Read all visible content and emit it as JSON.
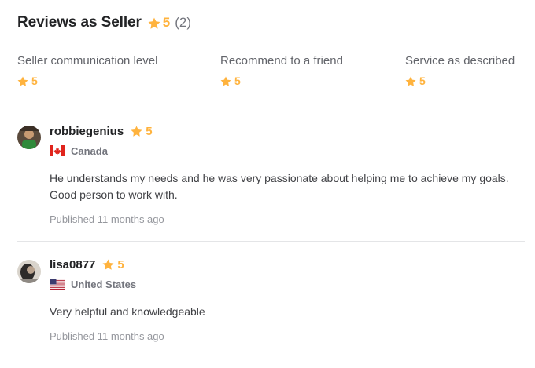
{
  "header": {
    "title": "Reviews as Seller",
    "rating": "5",
    "count": "(2)",
    "star_icon": "star-icon",
    "star_color": "#ffb33e"
  },
  "breakdown": [
    {
      "label": "Seller communication level",
      "rating": "5"
    },
    {
      "label": "Recommend to a friend",
      "rating": "5"
    },
    {
      "label": "Service as described",
      "rating": "5"
    }
  ],
  "reviews": [
    {
      "username": "robbiegenius",
      "rating": "5",
      "country": "Canada",
      "flag_icon": "canada-flag-icon",
      "text_line1": "He understands my needs and he was very passionate about helping me to achieve my goals.",
      "text_line2": "Good person to work with.",
      "published": "Published 11 months ago"
    },
    {
      "username": "lisa0877",
      "rating": "5",
      "country": "United States",
      "flag_icon": "us-flag-icon",
      "text_line1": "Very helpful and knowledgeable",
      "published": "Published 11 months ago"
    }
  ],
  "colors": {
    "accent_star": "#ffb33e",
    "heading": "#222325",
    "muted": "#74767e",
    "divider": "#e4e5e7"
  }
}
